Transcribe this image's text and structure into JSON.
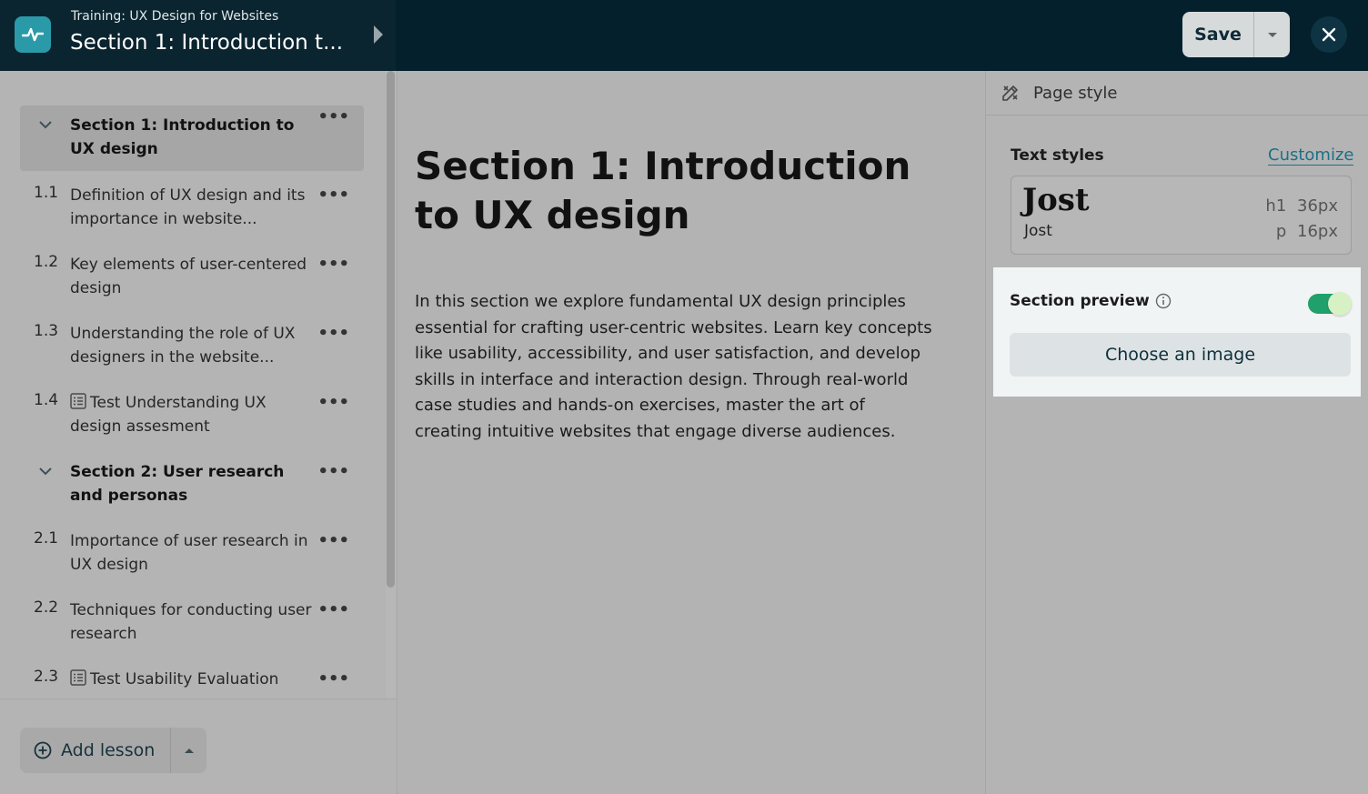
{
  "header": {
    "course_title": "Training: UX Design for Websites",
    "section_title": "Section 1: Introduction t...",
    "save_label": "Save"
  },
  "sidebar": {
    "items": [
      {
        "type": "section",
        "num": "",
        "label": "Section 1: Introduction to UX design",
        "active": true
      },
      {
        "type": "lesson",
        "num": "1.1",
        "label": "Definition of UX design and its importance in website..."
      },
      {
        "type": "lesson",
        "num": "1.2",
        "label": "Key elements of user-centered design"
      },
      {
        "type": "lesson",
        "num": "1.3",
        "label": "Understanding the role of UX designers in the website..."
      },
      {
        "type": "test",
        "num": "1.4",
        "label": "Test Understanding UX design assesment"
      },
      {
        "type": "section",
        "num": "",
        "label": "Section 2: User research and personas"
      },
      {
        "type": "lesson",
        "num": "2.1",
        "label": "Importance of user research in UX design"
      },
      {
        "type": "lesson",
        "num": "2.2",
        "label": "Techniques for conducting user research"
      },
      {
        "type": "test",
        "num": "2.3",
        "label": "Test Usability Evaluation"
      }
    ],
    "add_lesson_label": "Add lesson"
  },
  "main": {
    "heading": "Section 1: Introduction to UX design",
    "body": "In this section we explore fundamental UX design principles essential for crafting user-centric websites. Learn key concepts like usability, accessibility, and user satisfaction, and develop skills in interface and interaction design. Through real-world case studies and hands-on exercises, master the art of creating intuitive websites that engage diverse audiences."
  },
  "right_panel": {
    "header_label": "Page style",
    "text_styles_label": "Text styles",
    "customize_label": "Customize",
    "font_name_heading": "Jost",
    "font_name_body": "Jost",
    "h1_spec": "h1 36px",
    "p_spec": "p 16px",
    "section_preview_label": "Section preview",
    "section_preview_on": true,
    "choose_image_label": "Choose an image"
  },
  "colors": {
    "header_bg": "#03202c",
    "toggle_on": "#20a06b",
    "link": "#1e6f86",
    "logo_bg": "#2b9aa8"
  }
}
